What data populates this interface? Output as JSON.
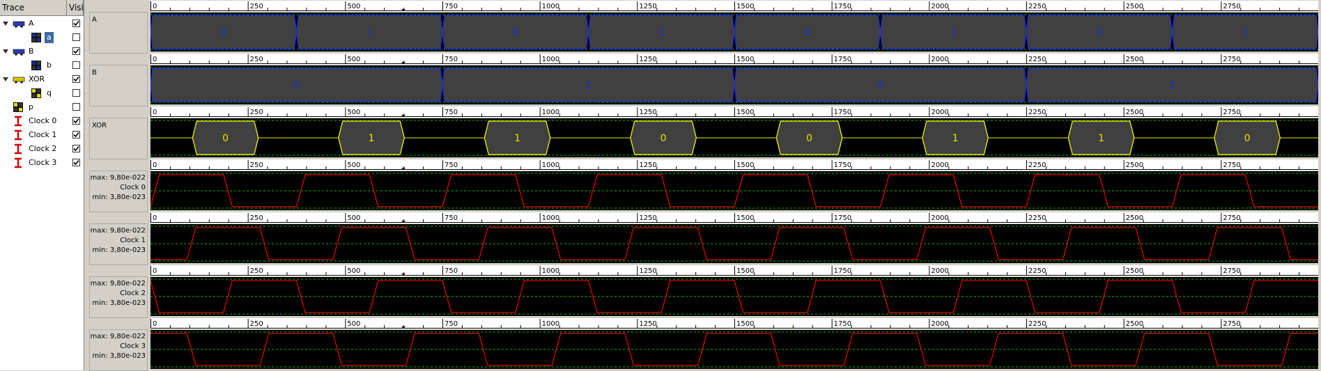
{
  "tree": {
    "col_trace": "Trace",
    "col_visible": "Visi",
    "rows": [
      {
        "label": "A",
        "indent": 0,
        "expander": true,
        "icon": "bus-blue-icon",
        "checked": true,
        "selected": false
      },
      {
        "label": "a",
        "indent": 1,
        "expander": false,
        "icon": "signal-blue-icon",
        "checked": false,
        "selected": true
      },
      {
        "label": "B",
        "indent": 0,
        "expander": true,
        "icon": "bus-blue-icon",
        "checked": true,
        "selected": false
      },
      {
        "label": "b",
        "indent": 1,
        "expander": false,
        "icon": "signal-blue-icon",
        "checked": false,
        "selected": false
      },
      {
        "label": "XOR",
        "indent": 0,
        "expander": true,
        "icon": "bus-yellow-icon",
        "checked": true,
        "selected": false
      },
      {
        "label": "q",
        "indent": 1,
        "expander": false,
        "icon": "signal-yellow-icon",
        "checked": false,
        "selected": false
      },
      {
        "label": "p",
        "indent": 0,
        "expander": false,
        "icon": "signal-yellow-icon",
        "checked": false,
        "selected": false
      },
      {
        "label": "Clock 0",
        "indent": 0,
        "expander": false,
        "icon": "clock-red-icon",
        "checked": true,
        "selected": false
      },
      {
        "label": "Clock 1",
        "indent": 0,
        "expander": false,
        "icon": "clock-red-icon",
        "checked": true,
        "selected": false
      },
      {
        "label": "Clock 2",
        "indent": 0,
        "expander": false,
        "icon": "clock-red-icon",
        "checked": true,
        "selected": false
      },
      {
        "label": "Clock 3",
        "indent": 0,
        "expander": false,
        "icon": "clock-red-icon",
        "checked": true,
        "selected": false
      }
    ]
  },
  "ruler": {
    "ticks": [
      "0",
      "250",
      "500",
      "750",
      "1000",
      "1250",
      "1500",
      "1750",
      "2000",
      "2250",
      "2500",
      "2750"
    ],
    "range_max": 3000,
    "minor_step": 50
  },
  "lanes": [
    {
      "kind": "bus",
      "name": "A",
      "period": 375,
      "values": [
        "0",
        "1",
        "0",
        "1",
        "0",
        "1",
        "0",
        "1"
      ],
      "fill": "#404040",
      "edge": "#1a2fd0",
      "text": "#1a2fd0"
    },
    {
      "kind": "bus",
      "name": "B",
      "period": 750,
      "values": [
        "0",
        "1",
        "0",
        "1"
      ],
      "fill": "#404040",
      "edge": "#1a2fd0",
      "text": "#1a2fd0"
    },
    {
      "kind": "xor",
      "name": "XOR",
      "period": 375,
      "values": [
        "0",
        "1",
        "1",
        "0",
        "0",
        "1",
        "1",
        "0"
      ],
      "fill": "#404040",
      "edge": "#e6e600",
      "text": "#e6e600"
    },
    {
      "kind": "clock",
      "name": "Clock 0",
      "max": "max: 9,80e-022",
      "min": "min: 3,80e-023",
      "period": 375,
      "phase": 0,
      "color": "#e00000"
    },
    {
      "kind": "clock",
      "name": "Clock 1",
      "max": "max: 9,80e-022",
      "min": "min: 3,80e-023",
      "period": 375,
      "phase": 0.25,
      "color": "#e00000"
    },
    {
      "kind": "clock",
      "name": "Clock 2",
      "max": "max: 9,80e-022",
      "min": "min: 3,80e-023",
      "period": 375,
      "phase": 0.5,
      "color": "#e00000"
    },
    {
      "kind": "clock",
      "name": "Clock 3",
      "max": "max: 9,80e-022",
      "min": "min: 3,80e-023",
      "period": 375,
      "phase": 0.75,
      "color": "#e00000"
    }
  ],
  "colors": {
    "plot_bg": "#000000",
    "grid": "#00c000",
    "ruler_bg": "#ffffff",
    "selection": "#3c6aa0"
  }
}
